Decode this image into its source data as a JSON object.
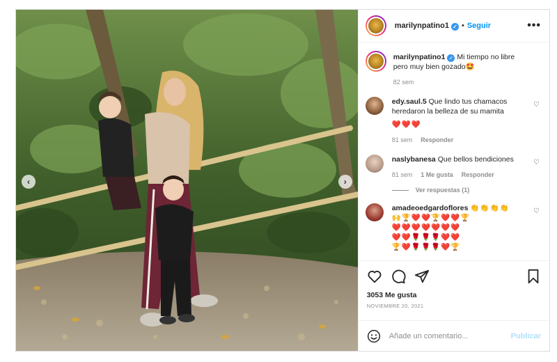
{
  "post": {
    "author": "marilynpatino1",
    "follow_label": "Seguir",
    "dot": "•",
    "more_label": "•••",
    "caption": {
      "username": "marilynpatino1",
      "text": "Mi tiempo no libre pero muy bien gozado🤩",
      "age": "82 sem"
    },
    "comments": [
      {
        "username": "edy.saul.5",
        "text": "Que lindo tus chamacos heredaron la belleza de su mamita",
        "emojis": "❤️❤️❤️",
        "age": "81 sem",
        "reply_label": "Responder"
      },
      {
        "username": "naslybanesa",
        "text": "Que bellos bendiciones",
        "age": "81 sem",
        "likes_label": "1 Me gusta",
        "reply_label": "Responder",
        "view_replies": "Ver respuestas (1)"
      },
      {
        "username": "amadeoedgardoflores",
        "text": "👏👏👏👏",
        "emoji_lines": [
          "🙌🏆❤️❤️🏆❤️❤️🏆",
          "❤️❤️❤️❤️❤️❤️❤️",
          "❤️❤️🌹🌹🌹❤️❤️",
          "🏆❤️🌹🌹🌹❤️🏆"
        ]
      }
    ],
    "likes": "3053 Me gusta",
    "date": "NOVIEMBRE 20, 2021",
    "comment_placeholder": "Añade un comentario...",
    "publish_label": "Publicar"
  },
  "colors": {
    "link_blue": "#0095f6",
    "verified_blue": "#3897f0",
    "publish_disabled": "#b2dffc",
    "muted": "#8e8e8e"
  },
  "icons": [
    "verified-badge-icon",
    "heart-icon",
    "comment-icon",
    "share-icon",
    "bookmark-icon",
    "emoji-icon",
    "chevron-left-icon",
    "chevron-right-icon"
  ]
}
